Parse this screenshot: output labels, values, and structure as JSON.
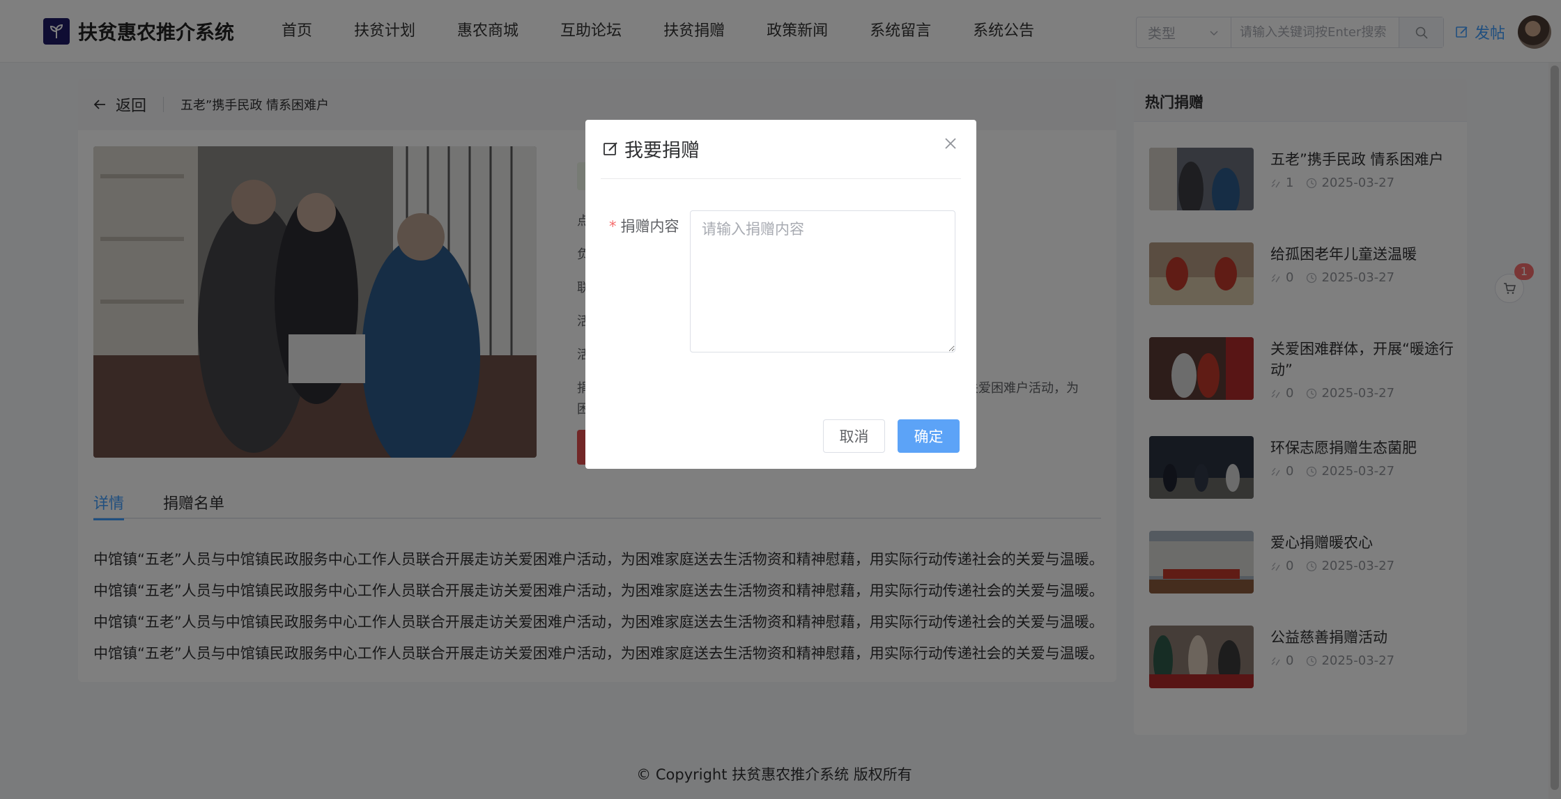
{
  "app": {
    "title": "扶贫惠农推介系统"
  },
  "nav": [
    {
      "label": "首页"
    },
    {
      "label": "扶贫计划"
    },
    {
      "label": "惠农商城"
    },
    {
      "label": "互助论坛"
    },
    {
      "label": "扶贫捐赠"
    },
    {
      "label": "政策新闻"
    },
    {
      "label": "系统留言"
    },
    {
      "label": "系统公告"
    }
  ],
  "search": {
    "type_placeholder": "类型",
    "placeholder": "请输入关键词按Enter搜索",
    "value": ""
  },
  "header": {
    "post_label": "发帖"
  },
  "detail": {
    "back_label": "返回",
    "title": "五老”携手民政 情系困难户",
    "info_snippets": [
      "点",
      "负",
      "联",
      "活",
      "活",
      "捐",
      "困"
    ],
    "info_tail": "访关爱困难户活动，为",
    "tabs": [
      {
        "label": "详情"
      },
      {
        "label": "捐赠名单"
      }
    ],
    "paragraphs": [
      "中馆镇“五老”人员与中馆镇民政服务中心工作人员联合开展走访关爱困难户活动，为困难家庭送去生活物资和精神慰藉，用实际行动传递社会的关爱与温暖。",
      "中馆镇“五老”人员与中馆镇民政服务中心工作人员联合开展走访关爱困难户活动，为困难家庭送去生活物资和精神慰藉，用实际行动传递社会的关爱与温暖。",
      "中馆镇“五老”人员与中馆镇民政服务中心工作人员联合开展走访关爱困难户活动，为困难家庭送去生活物资和精神慰藉，用实际行动传递社会的关爱与温暖。",
      "中馆镇“五老”人员与中馆镇民政服务中心工作人员联合开展走访关爱困难户活动，为困难家庭送去生活物资和精神慰藉，用实际行动传递社会的关爱与温暖。"
    ]
  },
  "hot": {
    "heading": "热门捐赠",
    "items": [
      {
        "title": "五老”携手民政 情系困难户",
        "likes": "1",
        "date": "2025-03-27"
      },
      {
        "title": "给孤困老年儿童送温暖",
        "likes": "0",
        "date": "2025-03-27"
      },
      {
        "title": "关爱困难群体，开展“暖途行动”",
        "likes": "0",
        "date": "2025-03-27"
      },
      {
        "title": "环保志愿捐赠生态菌肥",
        "likes": "0",
        "date": "2025-03-27"
      },
      {
        "title": "爱心捐赠暖农心",
        "likes": "0",
        "date": "2025-03-27"
      },
      {
        "title": "公益慈善捐赠活动",
        "likes": "0",
        "date": "2025-03-27"
      }
    ]
  },
  "cart": {
    "badge": "1"
  },
  "footer": {
    "text": "© Copyright 扶贫惠农推介系统 版权所有"
  },
  "dialog": {
    "title": "我要捐赠",
    "field_label": "捐赠内容",
    "required_mark": "*",
    "field_placeholder": "请输入捐赠内容",
    "field_value": "",
    "cancel_label": "取消",
    "confirm_label": "确定"
  },
  "colors": {
    "primary": "#409eff",
    "confirm": "#5ca3f7",
    "danger": "#f56c6c",
    "logo_bg": "#1f1a66"
  }
}
